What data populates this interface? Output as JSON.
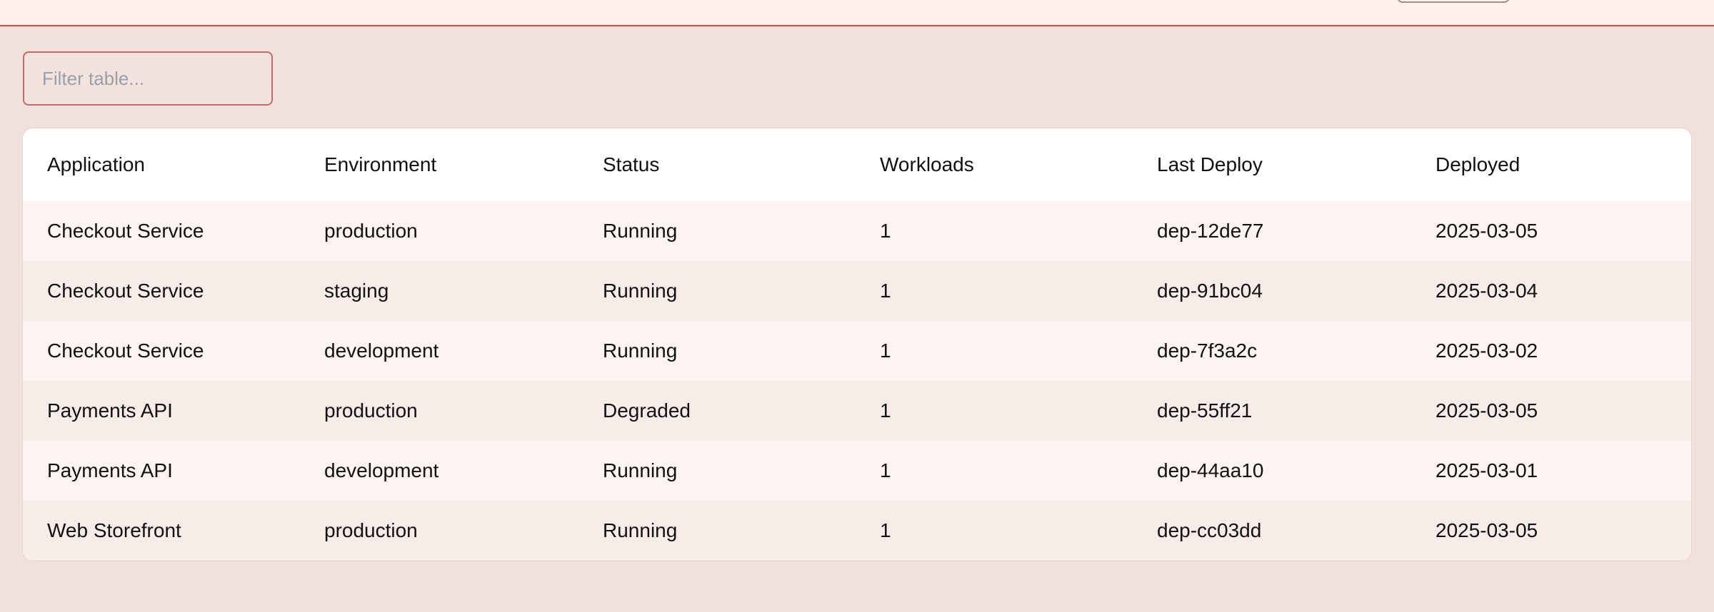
{
  "header": {},
  "filter": {
    "placeholder": "Filter table..."
  },
  "table": {
    "columns": [
      "Application",
      "Environment",
      "Status",
      "Workloads",
      "Last Deploy",
      "Deployed"
    ],
    "rows": [
      [
        "Checkout Service",
        "production",
        "Running",
        "1",
        "dep-12de77",
        "2025-03-05"
      ],
      [
        "Checkout Service",
        "staging",
        "Running",
        "1",
        "dep-91bc04",
        "2025-03-04"
      ],
      [
        "Checkout Service",
        "development",
        "Running",
        "1",
        "dep-7f3a2c",
        "2025-03-02"
      ],
      [
        "Payments API",
        "production",
        "Degraded",
        "1",
        "dep-55ff21",
        "2025-03-05"
      ],
      [
        "Payments API",
        "development",
        "Running",
        "1",
        "dep-44aa10",
        "2025-03-01"
      ],
      [
        "Web Storefront",
        "production",
        "Running",
        "1",
        "dep-cc03dd",
        "2025-03-05"
      ]
    ]
  },
  "colors": {
    "accent": "#d94a4a",
    "background": "#efe1db",
    "card": "#ffffff"
  }
}
